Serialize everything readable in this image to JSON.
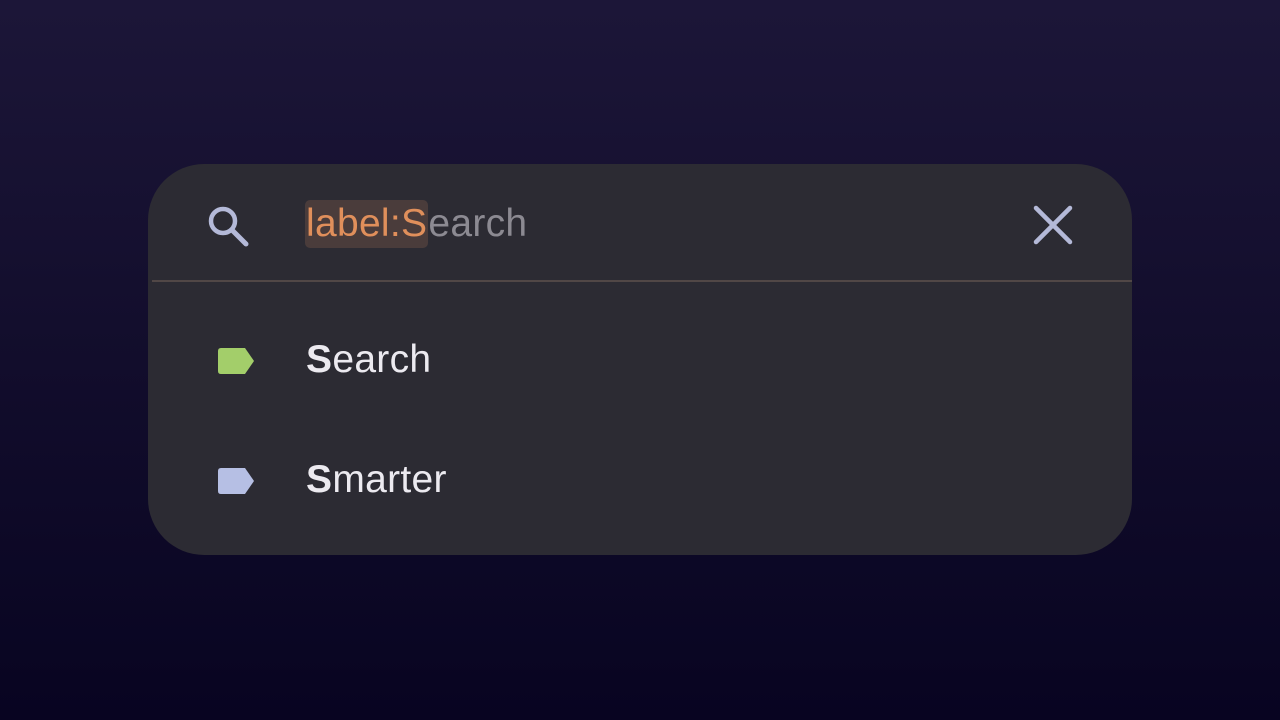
{
  "search": {
    "query_token": "label:S",
    "query_rest": "earch",
    "icon": "search-icon",
    "clear_icon": "close-icon"
  },
  "suggestions": [
    {
      "match": "S",
      "rest": "earch",
      "icon": "label-icon",
      "color": "#a3ce6a"
    },
    {
      "match": "S",
      "rest": "marter",
      "icon": "label-icon",
      "color": "#b6bfe4"
    }
  ],
  "colors": {
    "panel": "#2c2b33",
    "token_text": "#e08f5b",
    "token_bg": "#4a3c3b",
    "placeholder_text": "#8c8a92",
    "icon": "#b4b9d8"
  }
}
